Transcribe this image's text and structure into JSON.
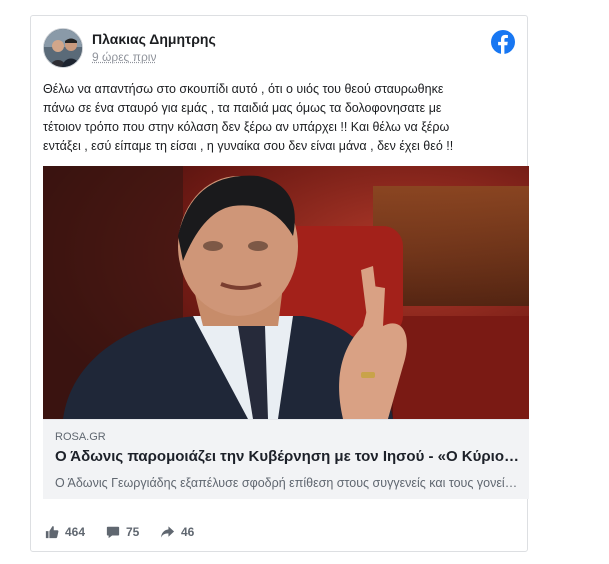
{
  "post": {
    "author": "Πλακιας Δημητρης",
    "timestamp": "9 ώρες πριν",
    "text_lines": [
      "Θέλω να απαντήσω στο σκουπίδι αυτό , ότι ο υιός του θεού σταυρωθηκε",
      "πάνω σε ένα σταυρό για εμάς , τα παιδιά μας όμως τα δολοφονησατε με",
      "τέτοιον τρόπο που στην κόλαση δεν ξέρω αν υπάρχει !! Και θέλω να ξέρω",
      "εντάξει , εσύ είπαμε τη είσαι , η γυναίκα σου δεν είναι μάνα , δεν έχει θεό !!"
    ]
  },
  "icons": {
    "brand": "facebook-icon",
    "like": "thumbs-up-icon",
    "comment": "comment-icon",
    "share": "share-icon",
    "brand_color": "#1877f2"
  },
  "link_preview": {
    "domain": "ROSA.GR",
    "title": "Ο Άδωνις παρομοιάζει την Κυβέρνηση με τον Ιησού - «Ο Κύριος σταυρώθηκε για τις αμαρτίες μας»",
    "description": "Ο Άδωνις Γεωργιάδης εξαπέλυσε σφοδρή επίθεση στους συγγενείς και τους γονείς των θυμάτων"
  },
  "stats": {
    "likes": "464",
    "comments": "75",
    "shares": "46"
  }
}
